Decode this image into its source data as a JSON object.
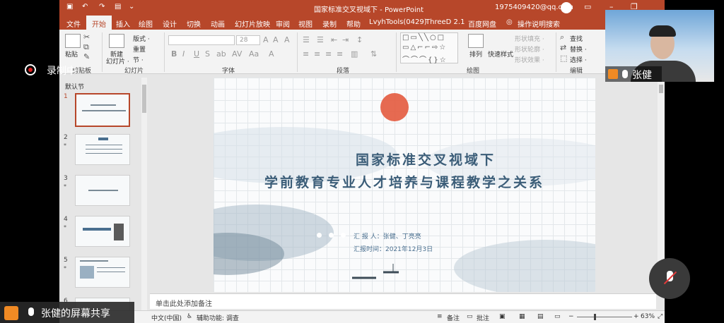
{
  "window": {
    "doc_title": "国家标准交叉视域下  -  PowerPoint",
    "user_email": "1975409420@qq.com"
  },
  "tabs": [
    "文件",
    "开始",
    "插入",
    "绘图",
    "设计",
    "切换",
    "动画",
    "幻灯片放映",
    "审阅",
    "视图",
    "录制",
    "帮助",
    "LvyhTools(0429)",
    "ThreeD 2.1",
    "百度网盘",
    "操作说明搜索"
  ],
  "ribbon": {
    "clipboard": {
      "paste": "粘贴",
      "label": "剪贴板"
    },
    "slides": {
      "new_slide": "新建\n幻灯片",
      "new_slide_1": "新建",
      "new_slide_2": "幻灯片 ·",
      "layout": "版式 ·",
      "reset": "重置",
      "section": "节 ·",
      "label": "幻灯片"
    },
    "font": {
      "size": "28",
      "label": "字体"
    },
    "paragraph": {
      "label": "段落"
    },
    "drawing": {
      "arrange": "排列",
      "quick_styles": "快速样式",
      "shape_fill": "形状填充 ·",
      "shape_outline": "形状轮廓 ·",
      "shape_effects": "形状效果 ·",
      "label": "绘图"
    },
    "editing": {
      "find": "查找",
      "replace": "替换 ·",
      "select": "选择 ·",
      "label": "编辑"
    }
  },
  "left_pane": {
    "section": "默认节",
    "slides": [
      {
        "num": "1",
        "star": ""
      },
      {
        "num": "2",
        "star": "*"
      },
      {
        "num": "3",
        "star": "*"
      },
      {
        "num": "4",
        "star": "*"
      },
      {
        "num": "5",
        "star": "*"
      },
      {
        "num": "6",
        "star": ""
      }
    ]
  },
  "slide": {
    "title_line1": "国家标准交叉视域下",
    "title_line2": "学前教育专业人才培养与课程教学之关系",
    "reporter": "汇  报  人：张健、丁亮亮",
    "time": "汇报时间：2021年12月3日"
  },
  "notes": {
    "placeholder": "单击此处添加备注"
  },
  "status": {
    "language": "中文(中国)",
    "accessibility": "辅助功能: 调查",
    "notes_btn": "备注",
    "comments_btn": "批注",
    "zoom": "63%"
  },
  "overlay": {
    "recording": "录制中",
    "camera_name": "张健",
    "share_label": "张健的屏幕共享"
  },
  "colors": {
    "accent": "#b7472a",
    "slide_text": "#3b5d78"
  }
}
